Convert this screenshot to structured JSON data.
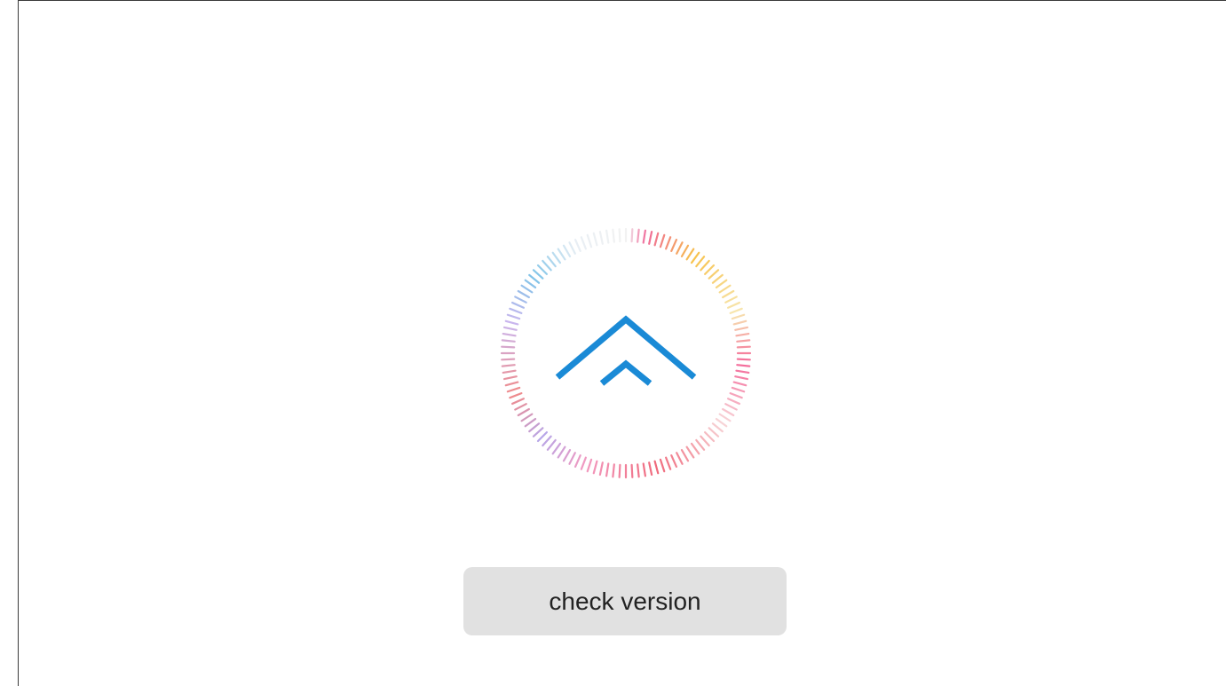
{
  "updater": {
    "icon": "update-arrow-icon",
    "accent_color": "#1a8ad6",
    "ring_colors": [
      "#f06a9a",
      "#f7c24c",
      "#f29aa0",
      "#f46a7c",
      "#f06aa0",
      "#9c8ed8",
      "#7fc4e8"
    ],
    "check_button_label": "check version"
  }
}
